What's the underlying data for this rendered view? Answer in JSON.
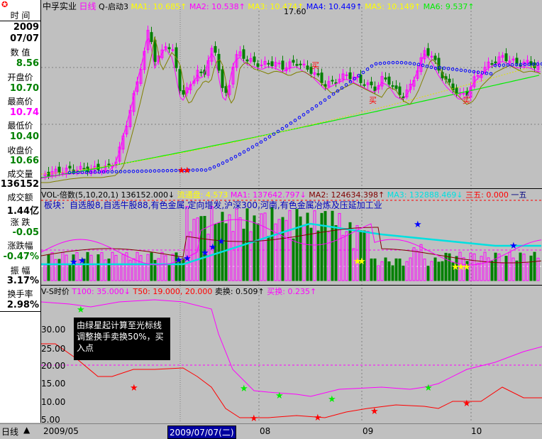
{
  "left_panel": {
    "labels": [
      "时 间",
      "数 值",
      "开盘价",
      "最高价",
      "最低价",
      "收盘价",
      "成交量",
      "成交额",
      "涨 跌",
      "涨跌幅",
      "振 幅",
      "换手率"
    ],
    "time_year": "2009",
    "time_date": "07/07",
    "value": "8.56",
    "open": "10.70",
    "high": "10.74",
    "low": "10.40",
    "close": "10.66",
    "volume": "136152",
    "amount": "1.44亿",
    "change": "-0.05",
    "change_pct": "-0.47%",
    "amplitude": "3.17%",
    "turnover": "2.98%"
  },
  "price_header": {
    "stock": "中孚实业",
    "period": "日线",
    "indicator": "Q-启动3",
    "ma1": "MA1: 10.685↑",
    "ma2": "MA2: 10.538↑",
    "ma3": "MA3: 10.474↑",
    "ma4": "MA4: 10.449↑",
    "ma5": "MA5: 10.149↑",
    "ma6": "MA6: 9.537↑",
    "peak_label": "17.60",
    "buy_marks": [
      "买",
      "买",
      "买"
    ]
  },
  "vol_header": {
    "name": "VOL-倍数(5,10,20,1)",
    "vol": "136152.000↓",
    "liutong": "流通盘: 4.573",
    "ma1": "MA1: 137642.797↓",
    "ma2": "MA2: 124634.398↑",
    "ma3": "MA3: 132888.469↓",
    "sanwu": "三五: 0.000",
    "yiwu": "一五",
    "sector": "板块：自选股8,自选牛股88,有色金属,定向增发,沪深300,河南,有色金属冶炼及压延加工业"
  },
  "vs_header": {
    "name": "V-S时价",
    "t100": "T100: 35.000↓",
    "t50": "T50: 19.000, 20.000",
    "sell": "卖换: 0.509↑",
    "buy": "买换: 0.235↑"
  },
  "vs_axis": [
    "30.00",
    "25.00",
    "20.00",
    "15.00",
    "10.00",
    "5.00"
  ],
  "annotation": "由绿星起计算至光标线调整换手卖换50%，买入点",
  "bottom_bar": {
    "tab": "日线",
    "dates": [
      "2009/05",
      "08",
      "09",
      "10"
    ],
    "cursor_date": "2009/07/07(二)"
  },
  "colors": {
    "up": "#ff00ff",
    "down": "#008000",
    "ma_green": "#00ee00",
    "blue_dots": "#0000ff",
    "cyan": "#00e0e0",
    "red": "#ff0000"
  }
}
